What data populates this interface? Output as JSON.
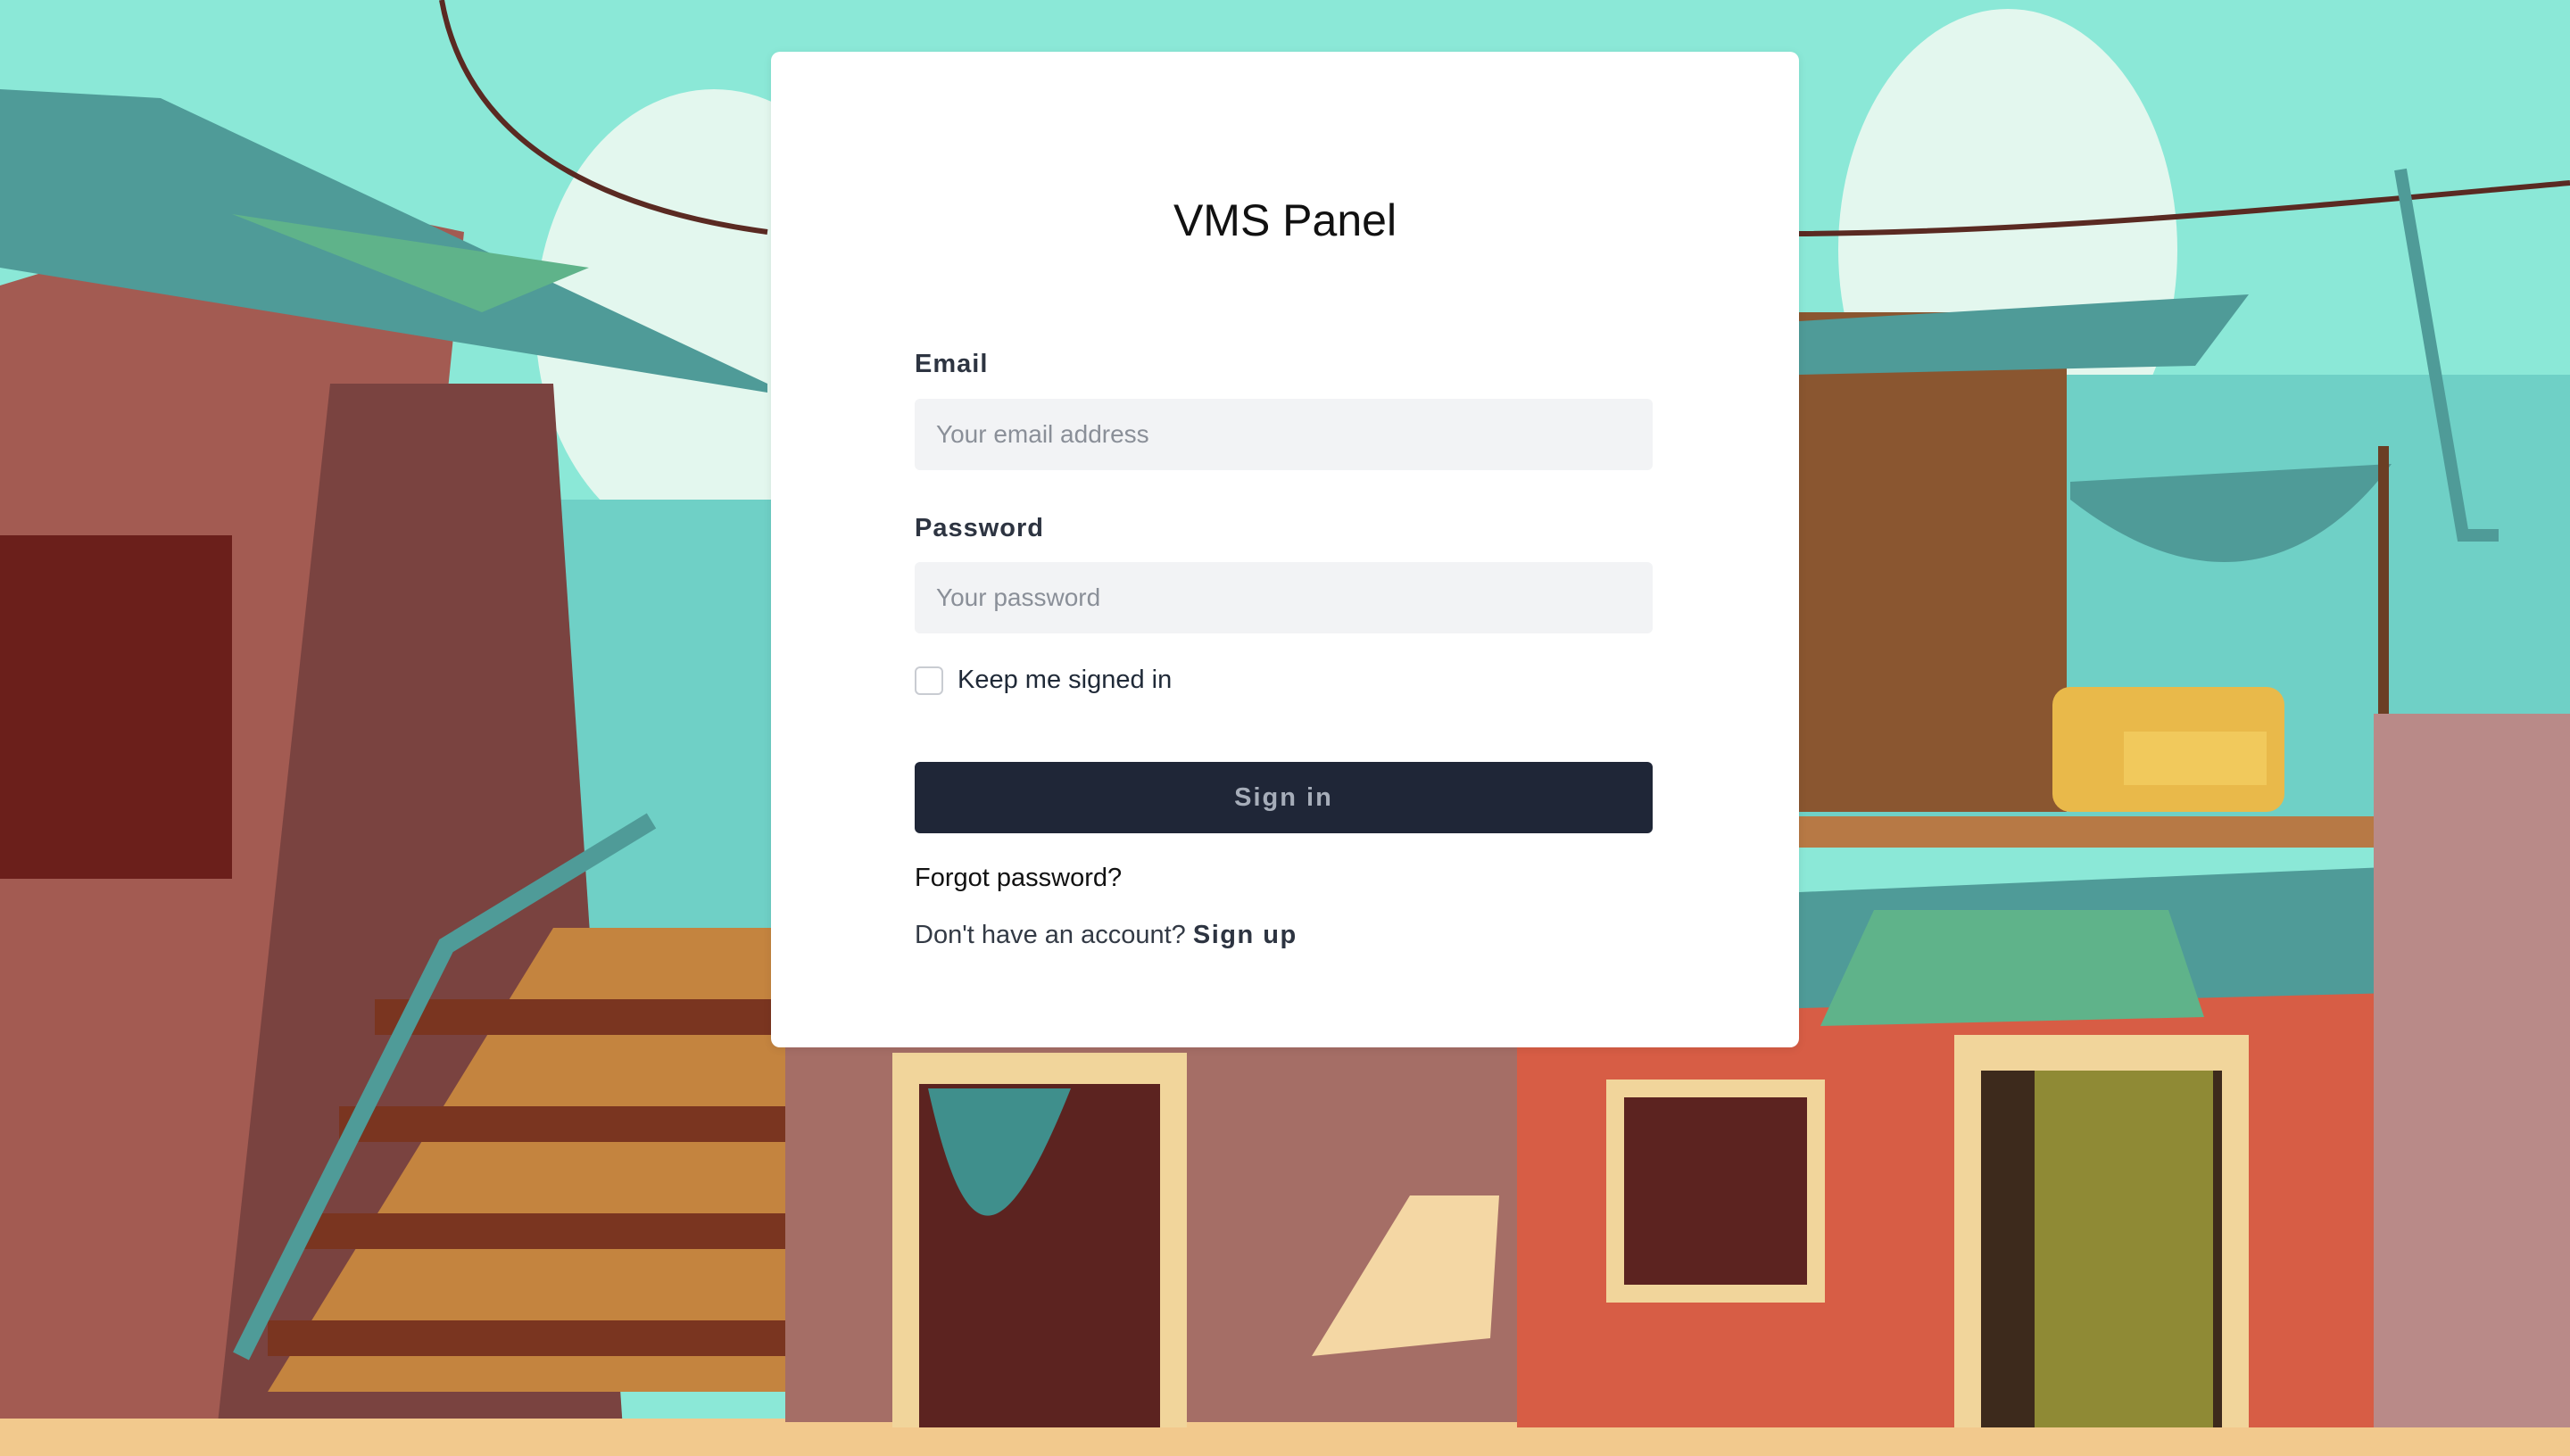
{
  "login": {
    "title": "VMS Panel",
    "email_label": "Email",
    "email_placeholder": "Your email address",
    "email_value": "",
    "password_label": "Password",
    "password_placeholder": "Your password",
    "password_value": "",
    "remember_label": "Keep me signed in",
    "remember_checked": false,
    "signin_label": "Sign in",
    "forgot_label": "Forgot password?",
    "no_account_text": "Don't have an account?",
    "signup_label": "Sign up"
  },
  "colors": {
    "sky": "#8be8d7",
    "button_bg": "#1f2637",
    "input_bg": "#f2f3f5",
    "card_bg": "#ffffff"
  },
  "icons": [
    "checkbox-icon"
  ]
}
